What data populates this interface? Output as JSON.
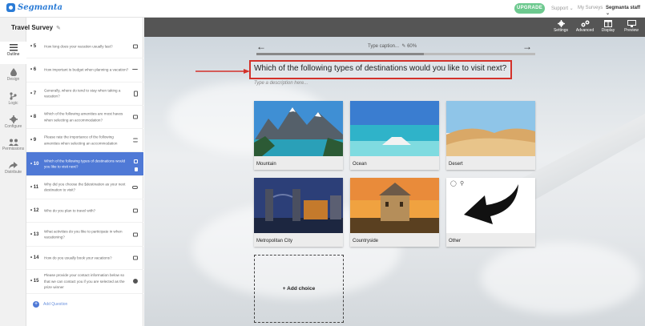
{
  "app": {
    "logo_text": "Segmanta",
    "brand_color": "#2a7bd6",
    "accent_color": "#4f79d6",
    "highlight_color": "#d3312a"
  },
  "topnav": {
    "upgrade": "UPGRADE",
    "support": "Support ⌄",
    "my_surveys": "My Surveys",
    "account": "Segmanta staff ⌄"
  },
  "sidebar": {
    "items": [
      {
        "label": "Outline",
        "icon": "list-icon"
      },
      {
        "label": "Design",
        "icon": "drop-icon"
      },
      {
        "label": "Logic",
        "icon": "branch-icon"
      },
      {
        "label": "Configure",
        "icon": "gear-icon"
      },
      {
        "label": "Permissions",
        "icon": "people-icon"
      },
      {
        "label": "Distribute",
        "icon": "share-icon"
      }
    ]
  },
  "outline": {
    "survey_title": "Travel Survey",
    "questions": [
      {
        "num": "5",
        "text": "How long does your vacation usually last?"
      },
      {
        "num": "6",
        "text": "How important is budget when planning a vacation?"
      },
      {
        "num": "7",
        "text": "Generally, where do tend to stay when taking a vacation?"
      },
      {
        "num": "8",
        "text": "Which of the following amenities are most haves when selecting an accommodation?"
      },
      {
        "num": "9",
        "text": "Please rate the importance of the following amenities when selecting an accommodation"
      },
      {
        "num": "10",
        "text": "Which of the following types of destinations would you like to visit next?"
      },
      {
        "num": "11",
        "text": "Why did you choose the $destination as your next destination to visit?"
      },
      {
        "num": "12",
        "text": "Who do you plan to travel with?"
      },
      {
        "num": "13",
        "text": "What activities do you like to participate in when vacationing?"
      },
      {
        "num": "14",
        "text": "How do you usually book your vacations?"
      },
      {
        "num": "15",
        "text": "Please provide your contact information below so that we can contact you if you are selected as the prize winner"
      }
    ],
    "add_question": "Add Question"
  },
  "toolbar": {
    "settings": "Settings",
    "advanced": "Advanced",
    "display": "Display",
    "preview": "Preview"
  },
  "editor": {
    "caption": "Type caption...",
    "progress": "60%",
    "progress_fraction": 0.6,
    "question": "Which of the following types of destinations would you like to visit next?",
    "description_placeholder": "Type a description here...",
    "choices": [
      "Mountain",
      "Ocean",
      "Desert",
      "Metropolitan City",
      "Countryside",
      "Other"
    ],
    "add_choice": "+ Add choice"
  }
}
